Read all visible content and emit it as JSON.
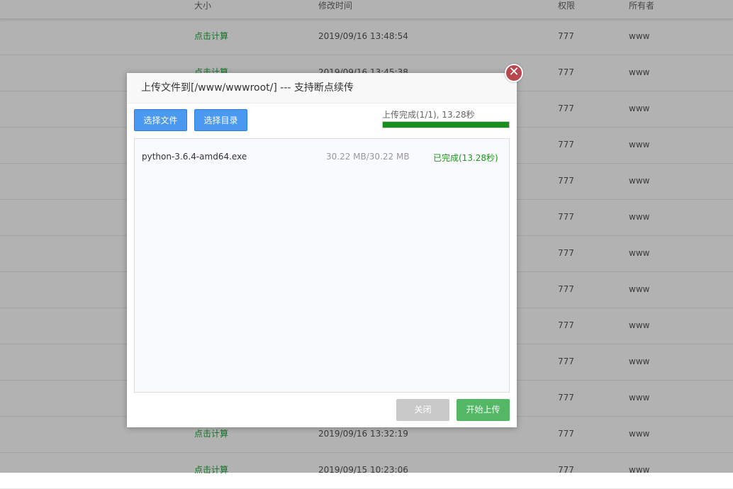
{
  "table": {
    "headers": {
      "size": "大小",
      "time": "修改时间",
      "perm": "权限",
      "owner": "所有者"
    },
    "rows": [
      {
        "size": "点击计算",
        "time": "2019/09/16 13:48:54",
        "perm": "777",
        "owner": "www"
      },
      {
        "size": "点击计算",
        "time": "2019/09/16 13:45:38",
        "perm": "777",
        "owner": "www"
      },
      {
        "size": "",
        "time": "",
        "perm": "777",
        "owner": "www"
      },
      {
        "size": "",
        "time": "",
        "perm": "777",
        "owner": "www"
      },
      {
        "size": "",
        "time": "",
        "perm": "777",
        "owner": "www"
      },
      {
        "size": "",
        "time": "",
        "perm": "777",
        "owner": "www"
      },
      {
        "size": "",
        "time": "",
        "perm": "777",
        "owner": "www"
      },
      {
        "size": "",
        "time": "",
        "perm": "777",
        "owner": "www"
      },
      {
        "size": "",
        "time": "",
        "perm": "777",
        "owner": "www"
      },
      {
        "size": "",
        "time": "",
        "perm": "777",
        "owner": "www"
      },
      {
        "size": "",
        "time": "",
        "perm": "777",
        "owner": "www"
      },
      {
        "size": "点击计算",
        "time": "2019/09/16 13:32:19",
        "perm": "777",
        "owner": "www"
      },
      {
        "size": "点击计算",
        "time": "2019/09/15 10:23:06",
        "perm": "777",
        "owner": "www"
      }
    ]
  },
  "dialog": {
    "title": "上传文件到[/www/wwwroot/] --- 支持断点续传",
    "close_icon": "✕",
    "select_files_label": "选择文件",
    "select_dir_label": "选择目录",
    "status": "上传完成(1/1), 13.28秒",
    "progress_percent": 100,
    "files": [
      {
        "name": "python-3.6.4-amd64.exe",
        "size": "30.22 MB/30.22 MB",
        "status": "已完成(13.28秒)"
      }
    ],
    "close_label": "关闭",
    "start_label": "开始上传"
  },
  "colors": {
    "accent_blue": "#4a98ef",
    "success_green": "#1c8c1c",
    "start_green": "#53b865"
  }
}
